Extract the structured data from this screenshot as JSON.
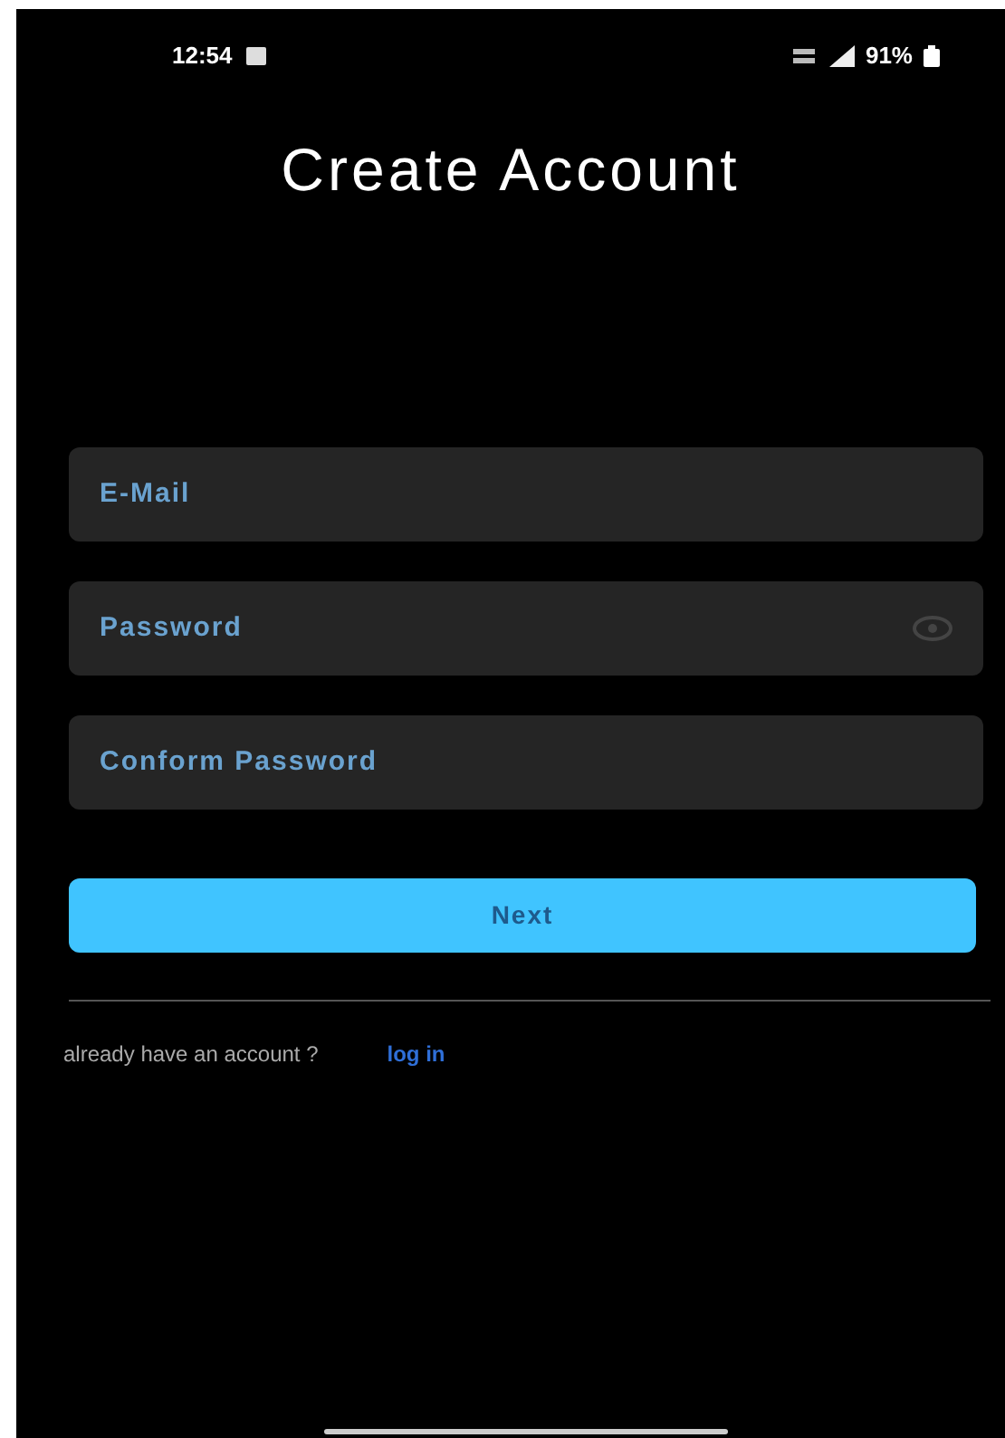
{
  "status_bar": {
    "time": "12:54",
    "battery": "91%"
  },
  "title": "Create Account",
  "fields": [
    {
      "placeholder": "E-Mail",
      "kind": "text"
    },
    {
      "placeholder": "Password",
      "kind": "password"
    },
    {
      "placeholder": "Conform Password",
      "kind": "text"
    }
  ],
  "next_button": "Next",
  "footer": {
    "prompt": "already have an account ?",
    "link": "log in"
  }
}
